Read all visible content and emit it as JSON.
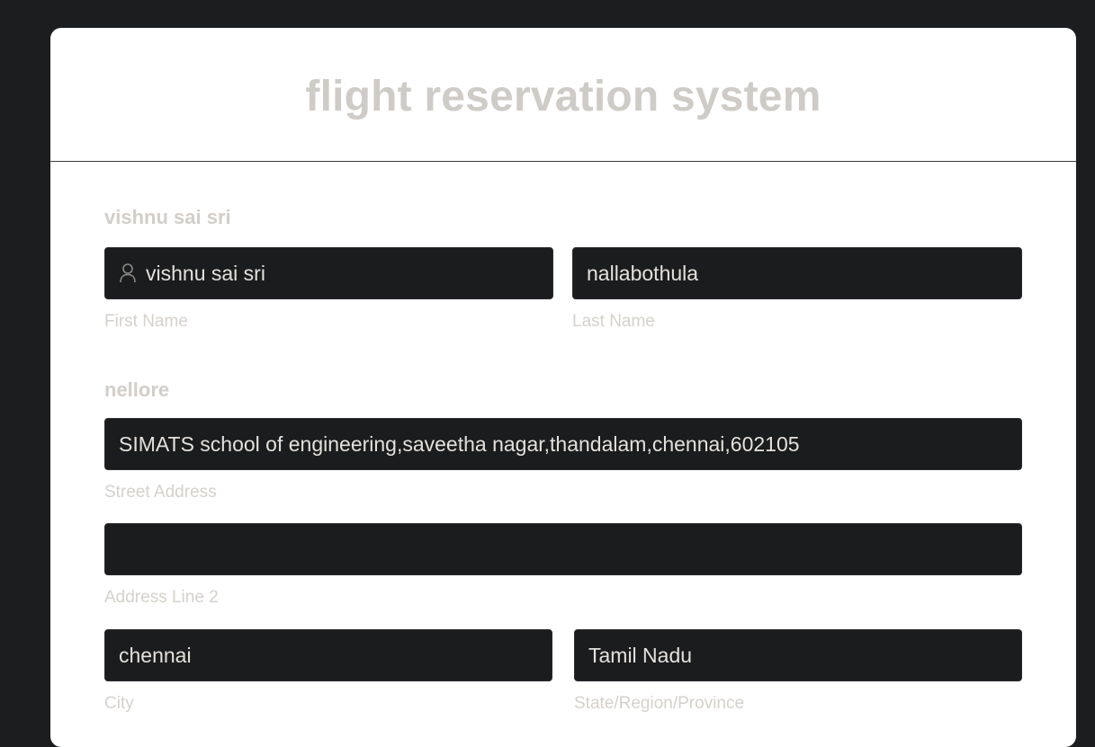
{
  "form": {
    "title": "flight reservation system",
    "name_section": {
      "label": "vishnu sai sri",
      "first_name_value": "vishnu sai sri",
      "first_name_label": "First Name",
      "last_name_value": "nallabothula",
      "last_name_label": "Last Name"
    },
    "address_section": {
      "label": "nellore",
      "street_address_value": "SIMATS school of engineering,saveetha nagar,thandalam,chennai,602105",
      "street_address_label": "Street Address",
      "address_line2_value": "",
      "address_line2_label": "Address Line 2",
      "city_value": "chennai",
      "city_label": "City",
      "state_value": "Tamil Nadu",
      "state_label": "State/Region/Province"
    },
    "icons": {
      "first_name_icon": "user-icon"
    },
    "colors": {
      "page_background": "#1c1d1f",
      "card_background": "#ffffff",
      "input_background": "#1b1c1e",
      "label_text": "#d5d1cc",
      "input_text": "#e4e1dc"
    }
  }
}
